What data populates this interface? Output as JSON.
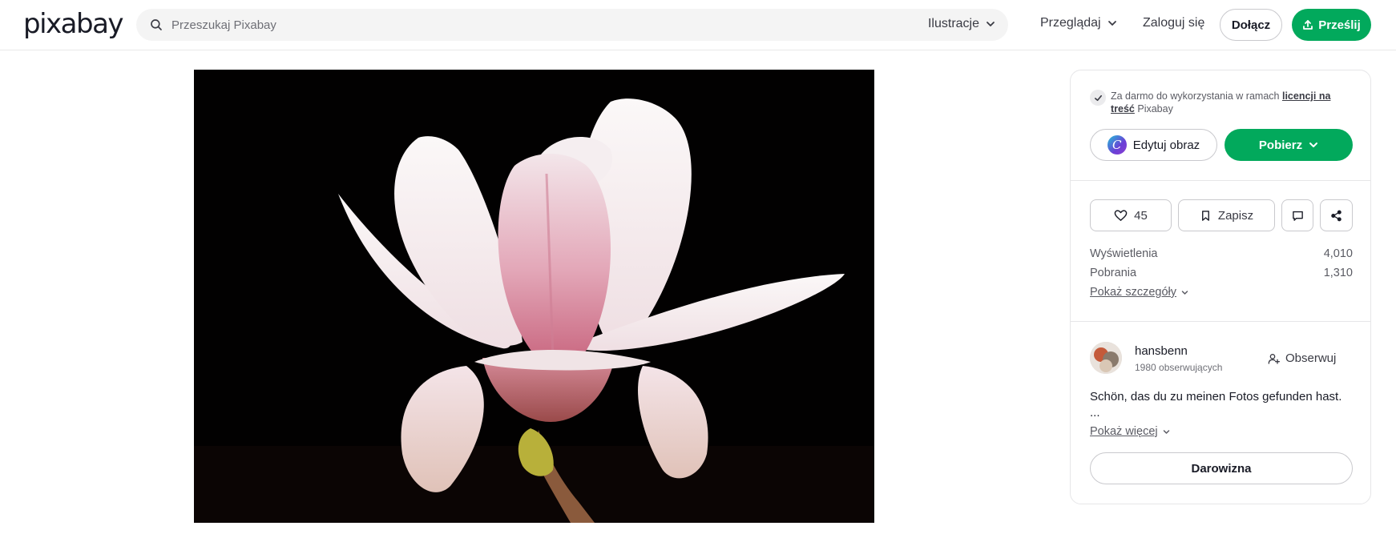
{
  "header": {
    "logo": "pixabay",
    "search_placeholder": "Przeszukaj Pixabay",
    "filter_label": "Ilustracje",
    "browse_label": "Przeglądaj",
    "login_label": "Zaloguj się",
    "join_label": "Dołącz",
    "upload_label": "Prześlij"
  },
  "sidebar": {
    "license": {
      "text_before": "Za darmo do wykorzystania w ramach ",
      "link": "licencji na treść",
      "text_after": " Pixabay"
    },
    "edit_label": "Edytuj obraz",
    "download_label": "Pobierz",
    "likes": "45",
    "save_label": "Zapisz",
    "stats": [
      {
        "label": "Wyświetlenia",
        "value": "4,010"
      },
      {
        "label": "Pobrania",
        "value": "1,310"
      }
    ],
    "details_label": "Pokaż szczegóły",
    "author": {
      "name": "hansbenn",
      "followers": "1980 obserwujących",
      "follow_label": "Obserwuj",
      "bio": "Schön, das du zu meinen Fotos gefunden hast.",
      "bio_ellipsis": "...",
      "more_label": "Pokaż więcej"
    },
    "donate_label": "Darowizna"
  },
  "colors": {
    "accent_green": "#02a95c",
    "text_dark": "#191b26",
    "border": "#c9c9cd",
    "search_bg": "#f4f4f4"
  },
  "icons": [
    "search-icon",
    "chevron-down-icon",
    "upload-icon",
    "check-icon",
    "canva-icon",
    "heart-icon",
    "bookmark-icon",
    "comment-icon",
    "share-icon",
    "add-user-icon"
  ]
}
